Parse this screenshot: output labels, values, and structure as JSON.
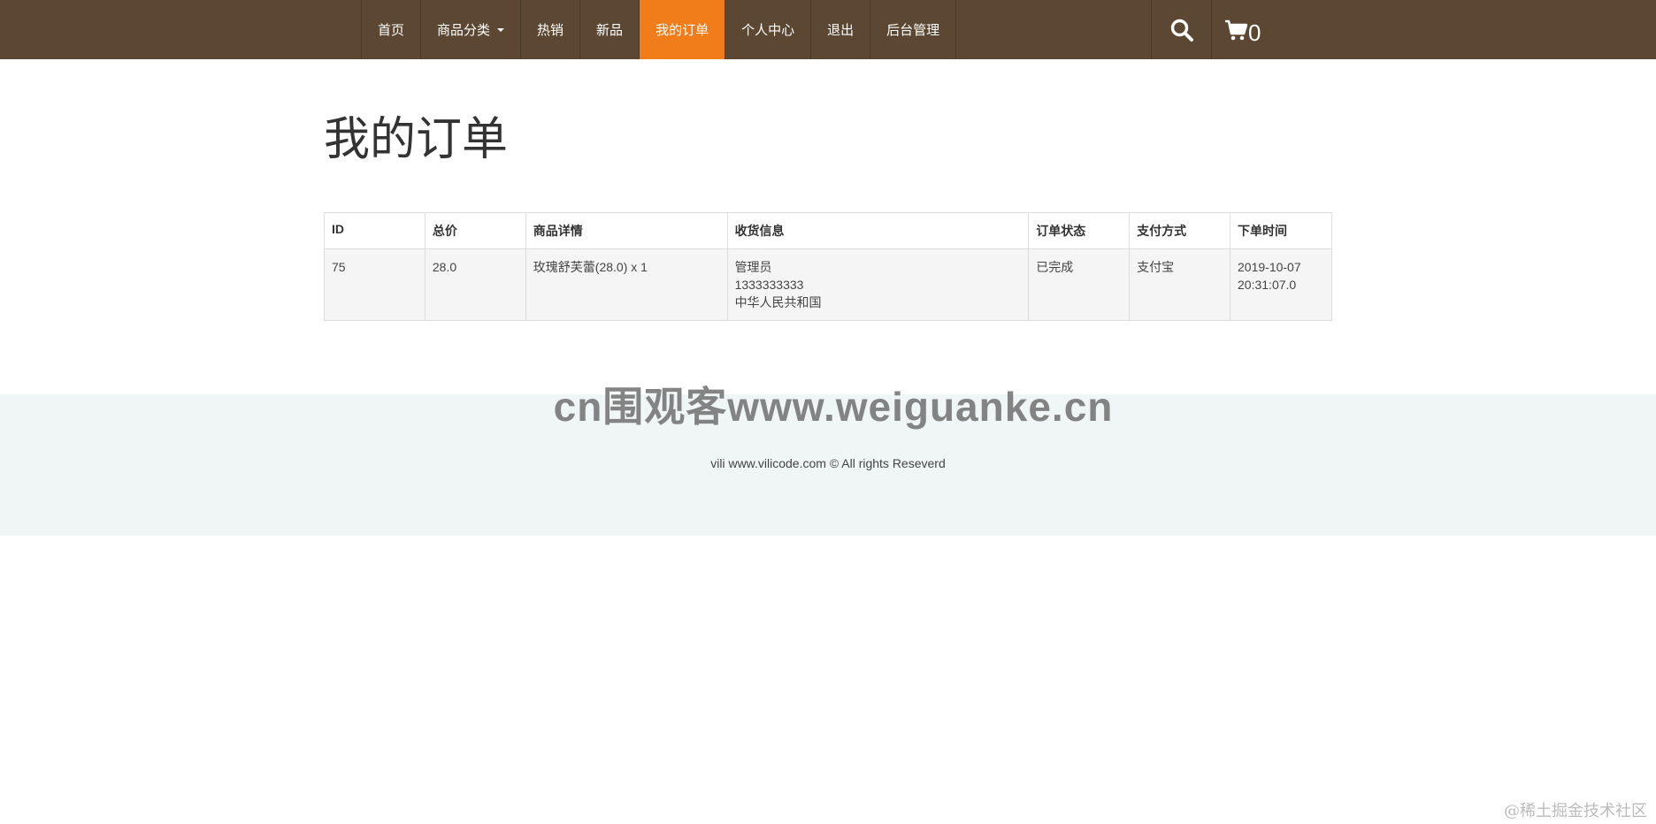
{
  "nav": {
    "items": [
      {
        "label": "首页",
        "active": false
      },
      {
        "label": "商品分类",
        "active": false,
        "dropdown": true
      },
      {
        "label": "热销",
        "active": false
      },
      {
        "label": "新品",
        "active": false
      },
      {
        "label": "我的订单",
        "active": true
      },
      {
        "label": "个人中心",
        "active": false
      },
      {
        "label": "退出",
        "active": false
      },
      {
        "label": "后台管理",
        "active": false
      }
    ],
    "cart_count": "0",
    "icons": {
      "search": "search-icon",
      "cart": "shopping-cart-icon"
    }
  },
  "page": {
    "title": "我的订单"
  },
  "table": {
    "headers": [
      "ID",
      "总价",
      "商品详情",
      "收货信息",
      "订单状态",
      "支付方式",
      "下单时间"
    ],
    "rows": [
      {
        "id": "75",
        "total": "28.0",
        "details": "玫瑰舒芙蕾(28.0) x 1",
        "receiver_name": "管理员",
        "receiver_phone": "1333333333",
        "receiver_address": "中华人民共和国",
        "status": "已完成",
        "payment": "支付宝",
        "time_date": "2019-10-07",
        "time_clock": "20:31:07.0"
      }
    ]
  },
  "watermark": "cn围观客www.weiguanke.cn",
  "footer": {
    "text": "vili www.vilicode.com © All rights Reseverd"
  },
  "corner_mark": "@稀土掘金技术社区",
  "colors": {
    "navbar": "#5c4832",
    "active_tab": "#f07d19",
    "footer_bg": "#f0f5f5"
  }
}
